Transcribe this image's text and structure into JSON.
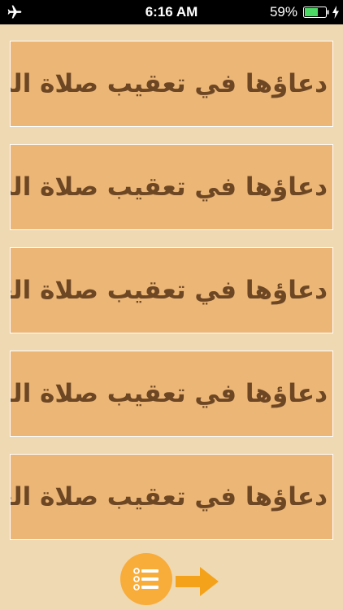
{
  "status_bar": {
    "time": "6:16 AM",
    "battery_percent": "59%",
    "icons": [
      "airplane-icon",
      "battery-icon",
      "charging-bolt-icon"
    ]
  },
  "prayers": [
    {
      "label": "دعاؤها في تعقيب صلاة الصبح"
    },
    {
      "label": "دعاؤها في تعقيب صلاة الظهر"
    },
    {
      "label": "دعاؤها في تعقيب صلاة العصر"
    },
    {
      "label": "دعاؤها في تعقيب صلاة المغرب"
    },
    {
      "label": "دعاؤها في تعقيب صلاة العشاء"
    }
  ],
  "bottom_bar": {
    "icons": [
      "list-menu-icon",
      "arrow-right-icon"
    ]
  },
  "colors": {
    "background": "#efd9b2",
    "item_background": "#ebb676",
    "item_text": "#6d4624",
    "accent": "#f8ac3a",
    "arrow": "#f4a21a"
  }
}
